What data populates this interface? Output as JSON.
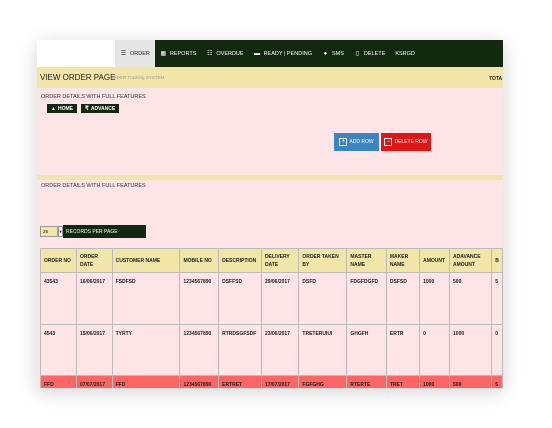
{
  "nav": [
    {
      "label": "ORDER",
      "icon": "list-icon",
      "active": true
    },
    {
      "label": "REPORTS",
      "icon": "grid-icon"
    },
    {
      "label": "OVERDUE",
      "icon": "list-icon"
    },
    {
      "label": "READY | PENDING",
      "icon": "truck-icon"
    },
    {
      "label": "SMS",
      "icon": "user-icon"
    },
    {
      "label": "DELETE",
      "icon": "trash-icon"
    },
    {
      "label": "KSRGD"
    }
  ],
  "title": "VIEW ORDER PAGE",
  "subtitle": "ORDER Tracking SYSTEM",
  "total_label": "TOTA",
  "section1": {
    "heading": "ORDER DETAILS WITH FULL FEATURES",
    "home_label": "HOME",
    "advance_label": "ADVANCE",
    "add_row_label": "ADD ROW",
    "delete_row_label": "DELETE ROW"
  },
  "section2": {
    "heading": "ORDER DETAILS WITH FULL FEATURES",
    "records_value": "25",
    "records_label": "RECORDS PER PAGE"
  },
  "table": {
    "columns": [
      "ORDER NO",
      "ORDER DATE",
      "CUSTOMER NAME",
      "MOBILE NO",
      "DESCRIPTION",
      "DELIVERY DATE",
      "ORDER TAKEN BY",
      "MASTER NAME",
      "MAKER NAME",
      "AMOUNT",
      "ADAVANCE AMOUNT",
      "B"
    ],
    "rows": [
      [
        "43543",
        "16/06/2017",
        "FSDFSD",
        "1234567890",
        "DSFFSD",
        "29/06/2017",
        "DSFD",
        "FDGFDGFD",
        "DSFSD",
        "1000",
        "500",
        "5"
      ],
      [
        "4543",
        "15/06/2017",
        "TYRTY",
        "1234567890",
        "RTRDSGFSDF",
        "23/06/2017",
        "TRETERUIUI",
        "GHGFH",
        "ERTR",
        "0",
        "1000",
        "0"
      ],
      [
        "FFD",
        "07/07/2017",
        "FFD",
        "1234567890",
        "ERTRET",
        "17/07/2017",
        "FGFGHG",
        "RTERTE",
        "TRET",
        "1000",
        "500",
        "5"
      ]
    ]
  }
}
